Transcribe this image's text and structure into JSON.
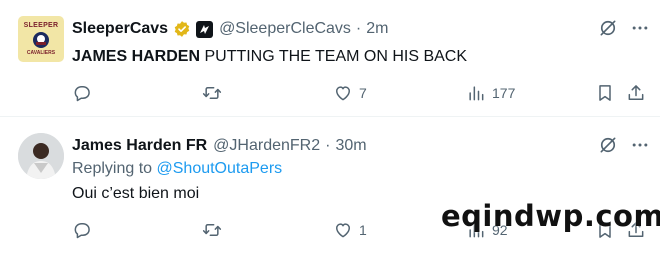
{
  "tweets": [
    {
      "avatar_text_top": "SLEEPER",
      "avatar_text_bottom": "CAVALIERS",
      "name": "SleeperCavs",
      "handle": "@SleeperCleCavs",
      "separator": "·",
      "time": "2m",
      "text_bold": "JAMES HARDEN",
      "text_rest": " PUTTING THE TEAM ON HIS BACK",
      "likes": "7",
      "views": "177"
    },
    {
      "name": "James Harden FR",
      "handle": "@JHardenFR2",
      "separator": "·",
      "time": "30m",
      "reply_prefix": "Replying to ",
      "reply_mention": "@ShoutOutaPers",
      "text": "Oui c’est bien moi",
      "likes": "1",
      "views": "92"
    }
  ],
  "watermark": "eqindwp.com",
  "colors": {
    "text": "#0f1419",
    "muted": "#536471",
    "link": "#1d9bf0",
    "verified_gold": "#e2b719",
    "divider": "#eff3f4"
  },
  "icons": [
    "reply-icon",
    "retweet-icon",
    "like-icon",
    "views-icon",
    "bookmark-icon",
    "share-icon",
    "grok-icon",
    "more-icon",
    "verified-badge-icon",
    "affiliate-icon"
  ]
}
